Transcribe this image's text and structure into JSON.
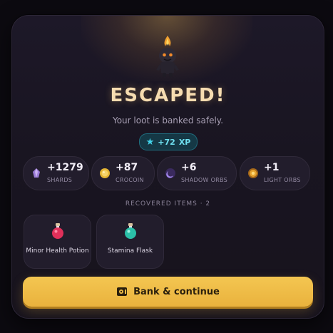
{
  "header": {
    "title": "ESCAPED!",
    "subtitle": "Your loot is banked safely."
  },
  "xp": {
    "value": "+72",
    "unit": "XP"
  },
  "rewards": [
    {
      "amount": "+1279",
      "label": "SHARDS",
      "icon": "shard-crystal-icon",
      "color": "#9a7bd6"
    },
    {
      "amount": "+87",
      "label": "CROCOIN",
      "icon": "crocoin-coin-icon",
      "color": "#e4b534"
    },
    {
      "amount": "+6",
      "label": "SHADOW ORBS",
      "icon": "shadow-orb-icon",
      "color": "#7a4fd0"
    },
    {
      "amount": "+1",
      "label": "LIGHT ORBS",
      "icon": "light-orb-icon",
      "color": "#e6a22c"
    }
  ],
  "recovered": {
    "label": "RECOVERED ITEMS · 2",
    "items": [
      {
        "name": "Minor Health Potion",
        "icon": "red-potion-icon",
        "color": "#e0305a"
      },
      {
        "name": "Stamina Flask",
        "icon": "teal-potion-icon",
        "color": "#2bc0a8"
      }
    ]
  },
  "cta": {
    "label": "Bank & continue",
    "icon": "bank-icon"
  },
  "colors": {
    "accent": "#f0bd48",
    "xp": "#6fe0f0",
    "title": "#f6dcb0"
  }
}
